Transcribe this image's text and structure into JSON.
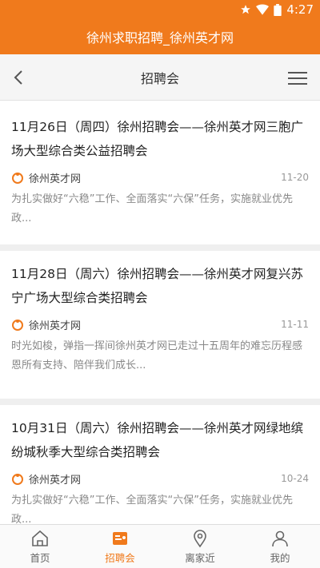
{
  "status": {
    "time": "4:27",
    "star_icon": "star-icon",
    "wifi_icon": "wifi-icon",
    "battery_icon": "battery-icon"
  },
  "app": {
    "title": "徐州求职招聘_徐州英才网"
  },
  "header": {
    "title": "招聘会",
    "back_icon": "chevron-left-icon",
    "menu_icon": "hamburger-menu-icon"
  },
  "feed": {
    "items": [
      {
        "title": "11月26日（周四）徐州招聘会——徐州英才网三胞广场大型综合类公益招聘会",
        "source": "徐州英才网",
        "date": "11-20",
        "summary": "为扎实做好“六稳”工作、全面落实“六保”任务，实施就业优先政..."
      },
      {
        "title": "11月28日（周六）徐州招聘会——徐州英才网复兴苏宁广场大型综合类招聘会",
        "source": "徐州英才网",
        "date": "11-11",
        "summary": "时光如梭，弹指一挥间徐州英才网已走过十五周年的难忘历程感恩所有支持、陪伴我们成长..."
      },
      {
        "title": "10月31日（周六）徐州招聘会——徐州英才网绿地缤纷城秋季大型综合类招聘会",
        "source": "徐州英才网",
        "date": "10-24",
        "summary": "为扎实做好“六稳”工作、全面落实“六保”任务，实施就业优先政..."
      }
    ]
  },
  "tabs": [
    {
      "label": "首页",
      "icon": "home-icon"
    },
    {
      "label": "招聘会",
      "icon": "job-fair-icon",
      "active": true
    },
    {
      "label": "离家近",
      "icon": "location-pin-icon"
    },
    {
      "label": "我的",
      "icon": "profile-icon"
    }
  ],
  "colors": {
    "accent": "#f07a1c",
    "background": "#efefef"
  }
}
